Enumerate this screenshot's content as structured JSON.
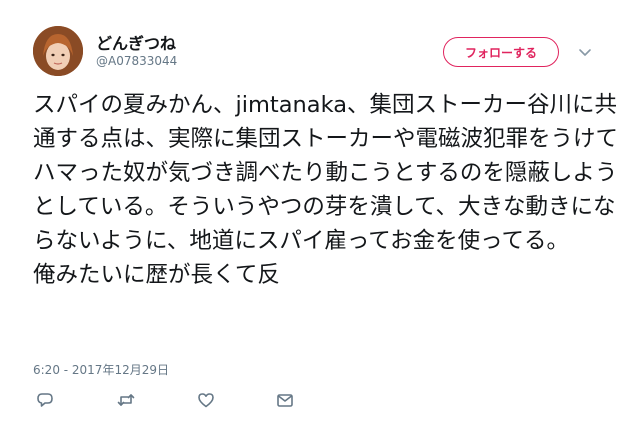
{
  "tweet": {
    "display_name": "どんぎつね",
    "username": "@A07833044",
    "follow_label": "フォローする",
    "text": "スパイの夏みかん、jimtanaka、集団ストーカー谷川に共通する点は、実際に集団ストーカーや電磁波犯罪をうけてハマった奴が気づき調べたり動こうとするのを隠蔽しようとしている。そういうやつの芽を潰して、大きな動きにならないように、地道にスパイ雇ってお金を使ってる。\n俺みたいに歴が長くて反",
    "timestamp": "6:20 - 2017年12月29日"
  },
  "icons": {
    "menu": "chevron-down-icon",
    "reply": "reply-icon",
    "retweet": "retweet-icon",
    "like": "heart-icon",
    "dm": "direct-message-icon"
  },
  "colors": {
    "accent": "#e0245e",
    "secondary_text": "#657786",
    "primary_text": "#14171a"
  }
}
